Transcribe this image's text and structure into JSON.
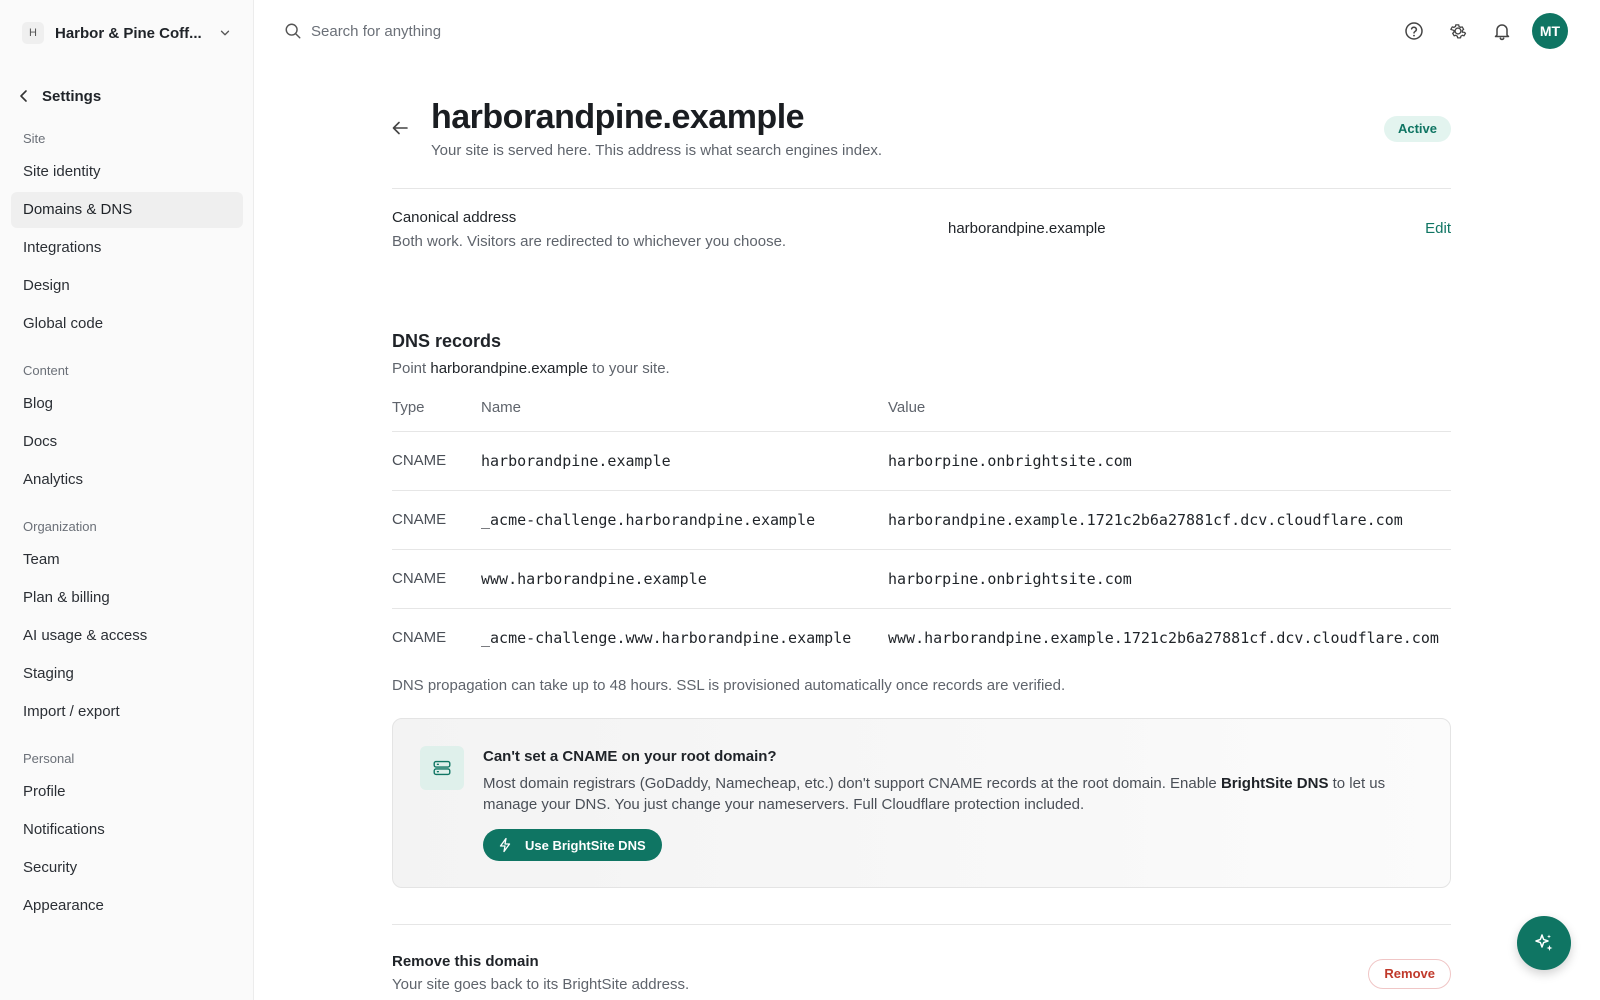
{
  "org": {
    "initial": "H",
    "name": "Harbor & Pine Coff..."
  },
  "settings_back": "Settings",
  "sidebar": {
    "groups": [
      {
        "title": "Site",
        "items": [
          "Site identity",
          "Domains & DNS",
          "Integrations",
          "Design",
          "Global code"
        ]
      },
      {
        "title": "Content",
        "items": [
          "Blog",
          "Docs",
          "Analytics"
        ]
      },
      {
        "title": "Organization",
        "items": [
          "Team",
          "Plan & billing",
          "AI usage & access",
          "Staging",
          "Import / export"
        ]
      },
      {
        "title": "Personal",
        "items": [
          "Profile",
          "Notifications",
          "Security",
          "Appearance"
        ]
      }
    ],
    "active_item": "Domains & DNS"
  },
  "search": {
    "placeholder": "Search for anything"
  },
  "user": {
    "initials": "MT"
  },
  "domain": {
    "title": "harborandpine.example",
    "subtitle": "Your site is served here. This address is what search engines index.",
    "status": "Active"
  },
  "canonical": {
    "label": "Canonical address",
    "description": "Both work. Visitors are redirected to whichever you choose.",
    "value": "harborandpine.example",
    "edit_label": "Edit"
  },
  "dns": {
    "title": "DNS records",
    "sub_prefix": "Point",
    "sub_domain": "harborandpine.example",
    "sub_suffix": "to your site.",
    "headers": {
      "type": "Type",
      "name": "Name",
      "value": "Value"
    },
    "records": [
      {
        "type": "CNAME",
        "name": "harborandpine.example",
        "value": "harborpine.onbrightsite.com"
      },
      {
        "type": "CNAME",
        "name": "_acme-challenge.harborandpine.example",
        "value": "harborandpine.example.1721c2b6a27881cf.dcv.cloudflare.com"
      },
      {
        "type": "CNAME",
        "name": "www.harborandpine.example",
        "value": "harborpine.onbrightsite.com"
      },
      {
        "type": "CNAME",
        "name": "_acme-challenge.www.harborandpine.example",
        "value": "www.harborandpine.example.1721c2b6a27881cf.dcv.cloudflare.com"
      }
    ],
    "propagation_note": "DNS propagation can take up to 48 hours. SSL is provisioned automatically once records are verified."
  },
  "callout": {
    "title": "Can't set a CNAME on your root domain?",
    "body_before": "Most domain registrars (GoDaddy, Namecheap, etc.) don't support CNAME records at the root domain. Enable",
    "body_bold": "BrightSite DNS",
    "body_after": "to let us manage your DNS. You just change your nameservers. Full Cloudflare protection included.",
    "button_label": "Use BrightSite DNS"
  },
  "remove": {
    "title": "Remove this domain",
    "description": "Your site goes back to its BrightSite address.",
    "button_label": "Remove"
  },
  "colors": {
    "accent": "#0f7563",
    "badge_bg": "#e3f4ef",
    "danger": "#c0392b"
  },
  "icons": [
    "chevron-down-icon",
    "chevron-left-icon",
    "search-icon",
    "help-icon",
    "gear-icon",
    "bell-icon",
    "arrow-left-icon",
    "server-icon",
    "bolt-icon",
    "sparkle-icon"
  ]
}
